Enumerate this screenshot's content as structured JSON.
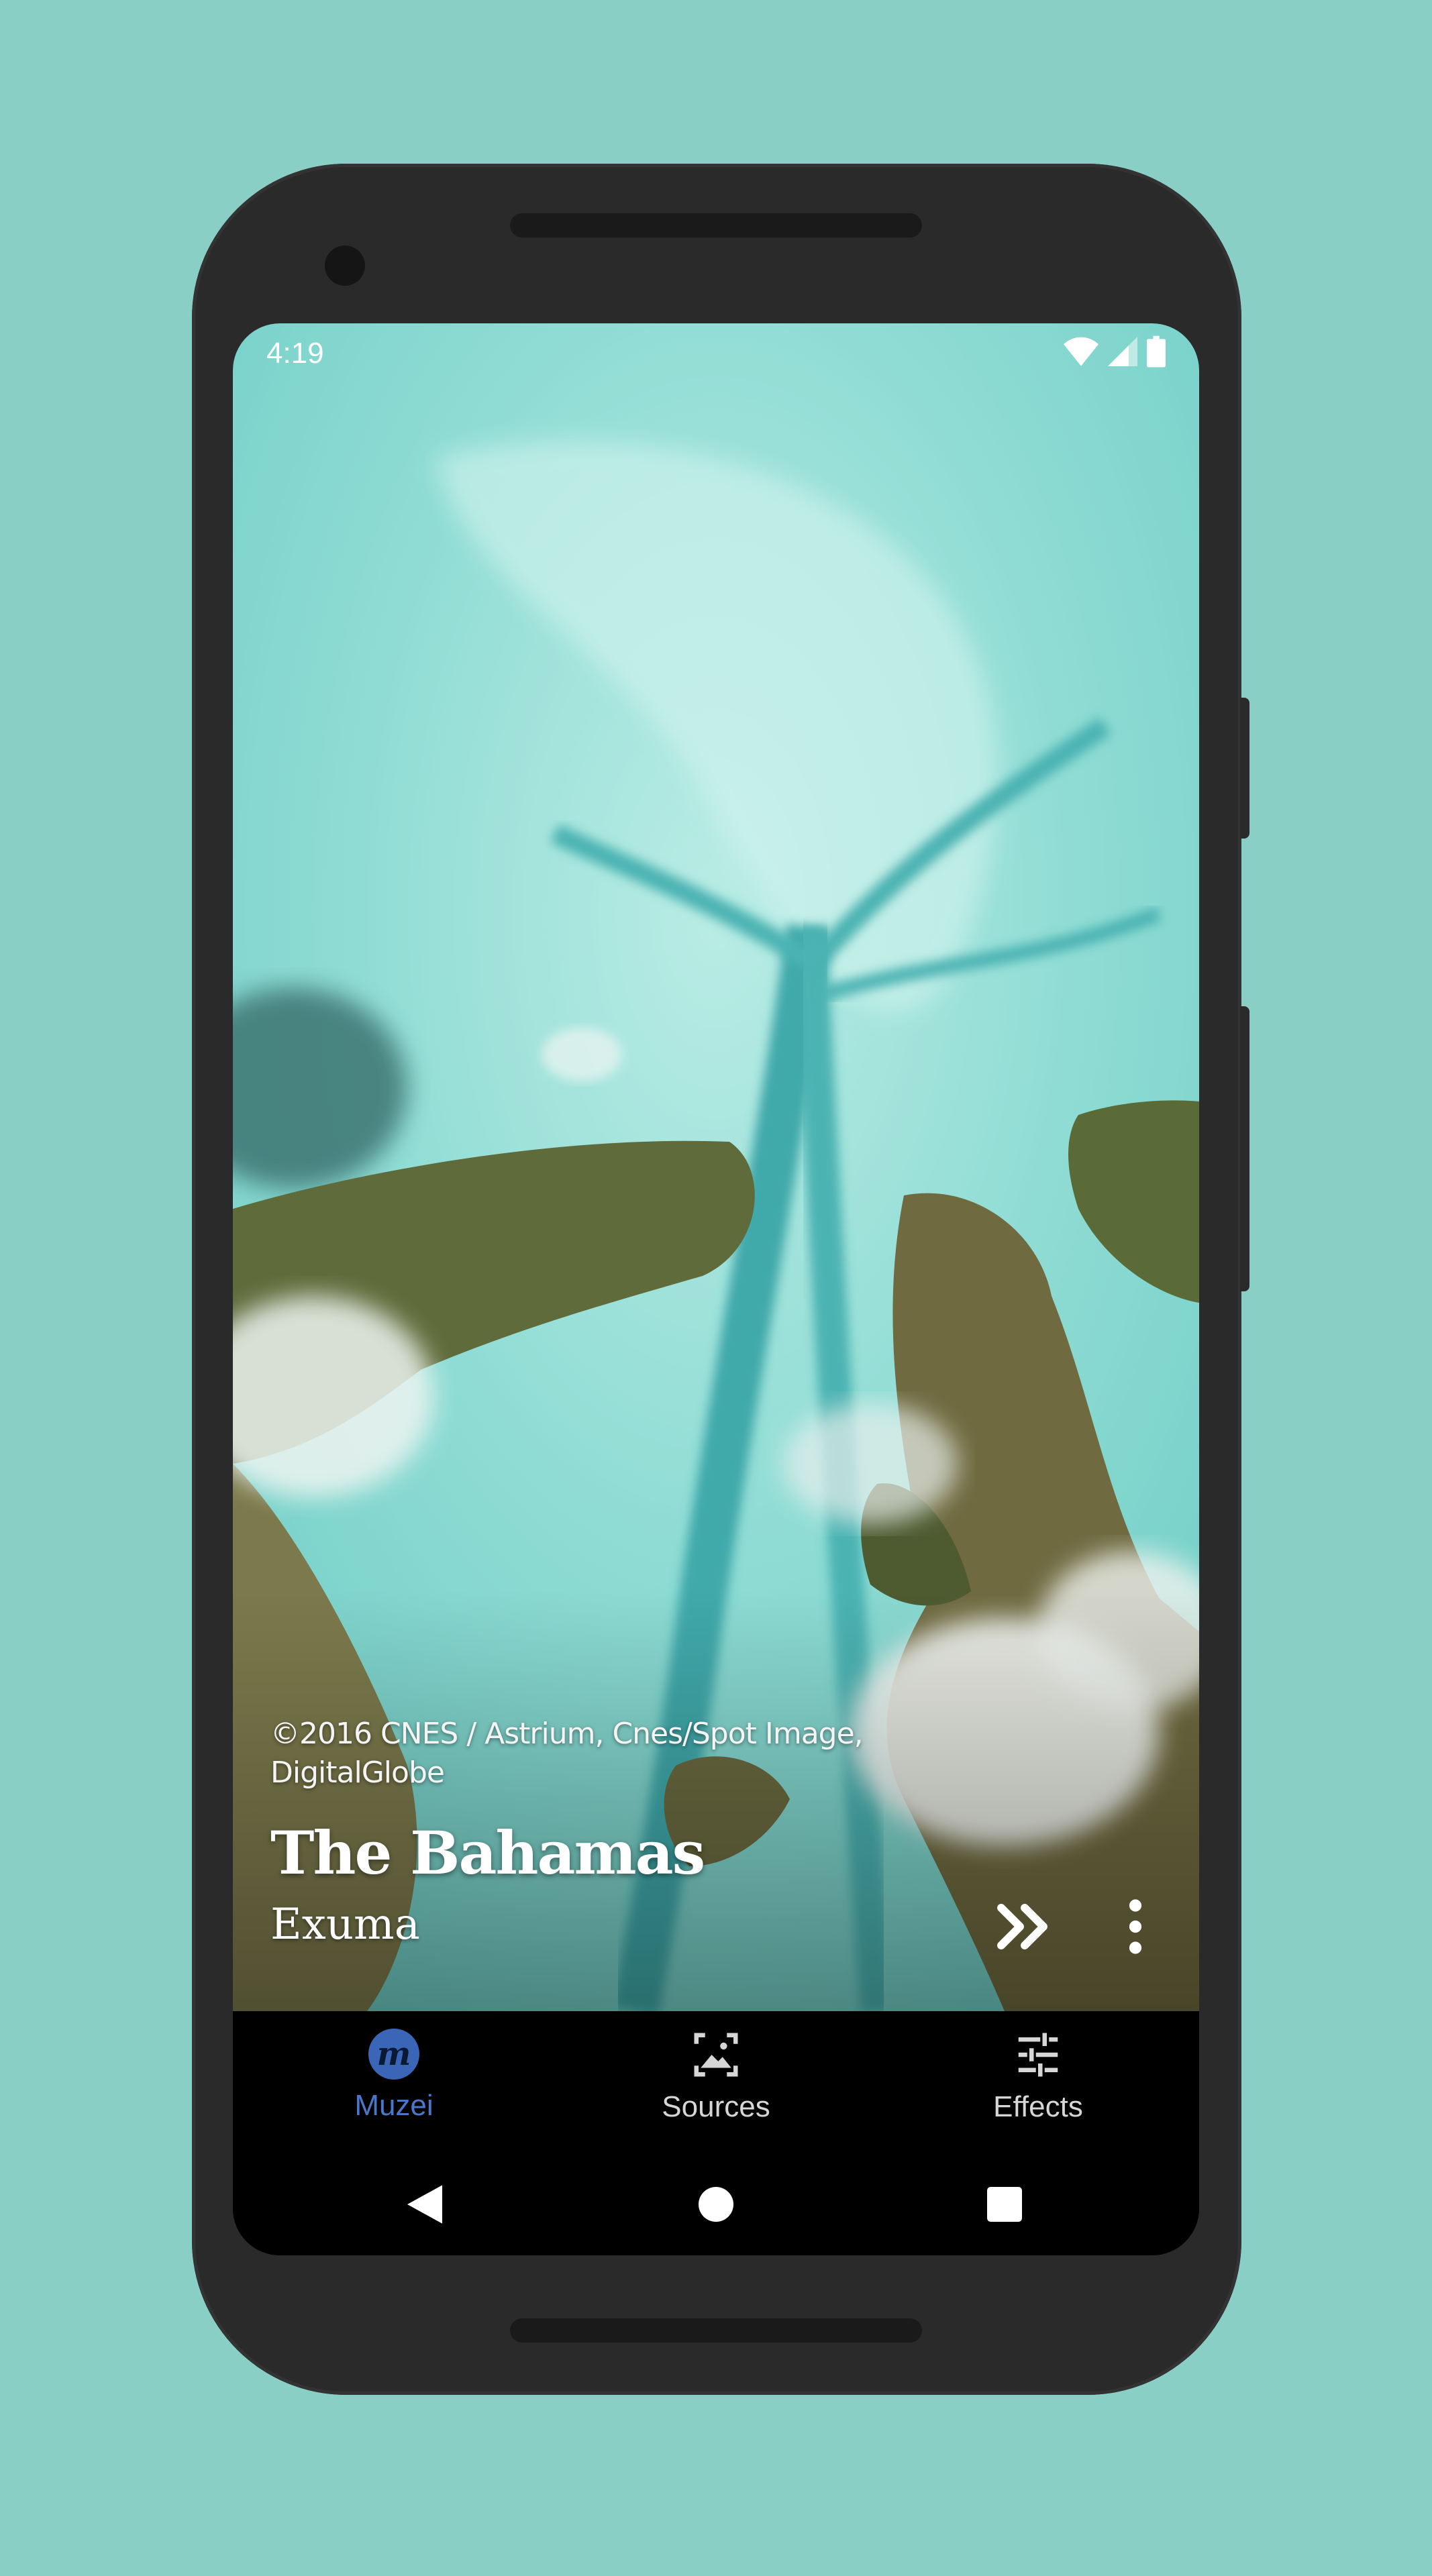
{
  "status_bar": {
    "time": "4:19",
    "icons": [
      "wifi-icon",
      "cell-signal-icon",
      "battery-icon"
    ]
  },
  "artwork": {
    "attribution": "©2016 CNES / Astrium, Cnes/Spot Image, DigitalGlobe",
    "title": "The Bahamas",
    "byline": "Exuma",
    "actions": [
      {
        "name": "next-artwork",
        "icon": "double-chevron-right-icon"
      },
      {
        "name": "overflow-menu",
        "icon": "more-vert-icon"
      }
    ]
  },
  "bottom_nav": {
    "items": [
      {
        "label": "Muzei",
        "icon": "muzei-logo-icon",
        "active": true,
        "logo_text": "m"
      },
      {
        "label": "Sources",
        "icon": "sources-icon",
        "active": false
      },
      {
        "label": "Effects",
        "icon": "tune-sliders-icon",
        "active": false
      }
    ]
  },
  "system_nav": [
    "back-icon",
    "home-icon",
    "recents-icon"
  ],
  "colors": {
    "background": "#89cfc6",
    "phone_body": "#2a2a2a",
    "accent": "#4a77c9",
    "nav_bar": "#000000",
    "water": "#7fd3cc",
    "land": "#5f6b3a"
  }
}
